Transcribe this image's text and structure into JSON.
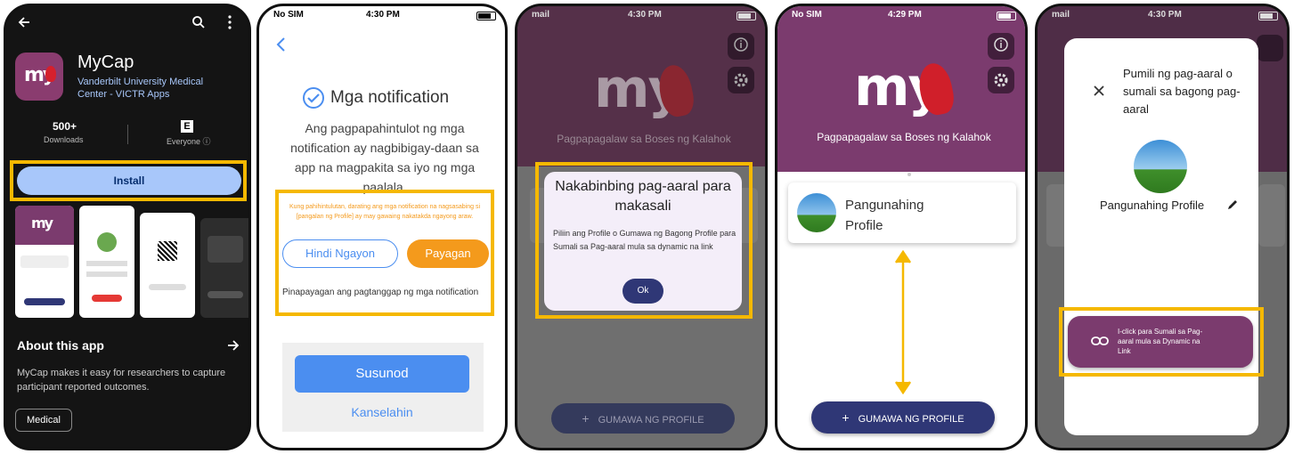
{
  "panel1": {
    "app_name": "MyCap",
    "developer": "Vanderbilt University Medical Center - VICTR Apps",
    "downloads_value": "500+",
    "downloads_label": "Downloads",
    "rating_label": "Everyone ⓘ",
    "install_label": "Install",
    "about_title": "About this app",
    "about_text": "MyCap makes it easy for researchers to capture participant reported outcomes.",
    "chip_label": "Medical",
    "logo_text": "my"
  },
  "panel2": {
    "status_carrier": "No SIM",
    "status_time": "4:30 PM",
    "title": "Mga notification",
    "desc": "Ang pagpapahintulot ng mga notification ay nagbibigay-daan sa app na magpakita sa iyo ng mga paalala.",
    "warn": "Kung pahihintulutan, darating ang mga notification na nagsasabing si [pangalan ng Profile] ay may gawaing nakatakda ngayong araw.",
    "btn_no": "Hindi Ngayon",
    "btn_yes": "Payagan",
    "status_msg": "Pinapayagan ang pagtanggap ng mga notification",
    "next": "Susunod",
    "cancel": "Kanselahin"
  },
  "panel3": {
    "status_carrier": "mail",
    "status_time": "4:30 PM",
    "logo_text": "my",
    "subtitle": "Pagpapagalaw sa Boses ng Kalahok",
    "dialog_title": "Nakabinbing pag-aaral para makasali",
    "dialog_body": "Piliin ang Profile o Gumawa ng Bagong Profile para Sumali sa Pag-aaral mula sa dynamic na link",
    "ok": "Ok",
    "create_btn": "GUMAWA NG PROFILE",
    "plus": "+"
  },
  "panel4": {
    "status_carrier": "No SIM",
    "status_time": "4:29 PM",
    "logo_text": "my",
    "subtitle": "Pagpapagalaw sa Boses ng Kalahok",
    "profile_name": "Pangunahing Profile",
    "create_btn": "GUMAWA NG PROFILE",
    "plus": "+"
  },
  "panel5": {
    "status_carrier": "mail",
    "status_time": "4:30 PM",
    "sheet_title": "Pumili ng pag-aaral o sumali sa bagong pag-aaral",
    "profile_name": "Pangunahing Profile",
    "join_btn": "I-click para Sumali sa Pag-aaral mula sa Dynamic na Link"
  },
  "colors": {
    "highlight": "#f5b800",
    "brand_purple": "#7b3b6e",
    "header_purple": "#6f3a63",
    "install_blue": "#a8c7fa",
    "allow_orange": "#f49a1c",
    "next_blue": "#4b8ef0",
    "navy": "#2f3776"
  }
}
